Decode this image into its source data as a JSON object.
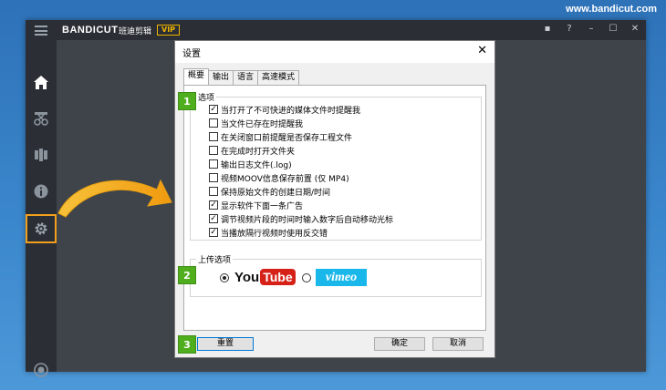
{
  "site_url": "www.bandicut.com",
  "app": {
    "logo": "BANDICUT",
    "logo_cn": "班迪剪辑",
    "vip": "VIP",
    "window_controls": [
      "▪",
      "?",
      "–",
      "☐",
      "✕"
    ]
  },
  "sidebar": {
    "items": [
      {
        "icon": "home-icon"
      },
      {
        "icon": "cut-icon"
      },
      {
        "icon": "join-icon"
      },
      {
        "icon": "info-icon"
      },
      {
        "icon": "gear-icon",
        "highlighted": true
      },
      {
        "icon": "record-icon"
      }
    ],
    "highlight_color": "#f2a01c"
  },
  "dialog": {
    "title": "设置",
    "close": "✕",
    "tabs": [
      "概要",
      "输出",
      "语言",
      "高速模式"
    ],
    "active_tab": 0,
    "options_group": {
      "label": "选项",
      "items": [
        {
          "label": "当打开了不可快进的媒体文件时提醒我",
          "checked": true
        },
        {
          "label": "当文件已存在时提醒我",
          "checked": false
        },
        {
          "label": "在关闭窗口前提醒是否保存工程文件",
          "checked": false
        },
        {
          "label": "在完成时打开文件夹",
          "checked": false
        },
        {
          "label": "输出日志文件(.log)",
          "checked": false
        },
        {
          "label": "视频MOOV信息保存前置 (仅 MP4)",
          "checked": false
        },
        {
          "label": "保持原始文件的创建日期/时间",
          "checked": false
        },
        {
          "label": "显示软件下面一条广告",
          "checked": true
        },
        {
          "label": "调节视频片段的时间时输入数字后自动移动光标",
          "checked": true
        },
        {
          "label": "当播放隔行视频时使用反交错",
          "checked": true
        }
      ]
    },
    "upload_group": {
      "label": "上传选项",
      "youtube_you": "You",
      "youtube_tube": "Tube",
      "vimeo": "vimeo",
      "selected": "youtube"
    },
    "buttons": {
      "reset": "重置",
      "ok": "确定",
      "cancel": "取消"
    }
  },
  "badges": [
    "1",
    "2",
    "3"
  ],
  "colors": {
    "badge": "#4fae1e",
    "youtube_red": "#d62118",
    "vimeo_blue": "#1ab7ea",
    "arrow": "#f5b21a"
  }
}
